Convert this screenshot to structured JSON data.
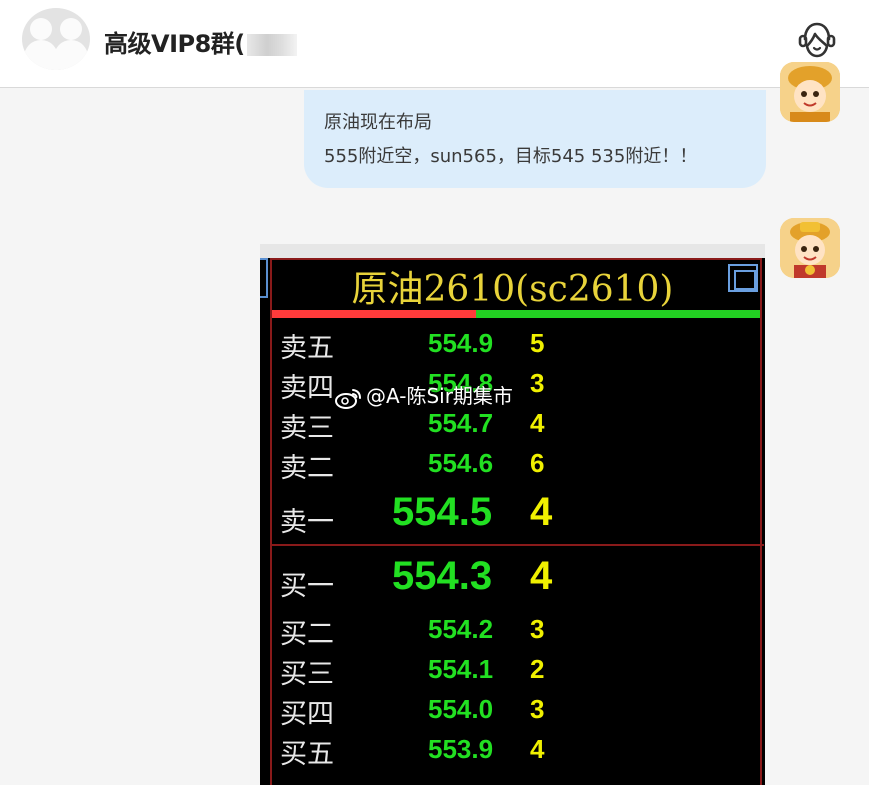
{
  "header": {
    "title": "高级VIP8群(",
    "service_icon": "customer-service-icon"
  },
  "messages": {
    "text_message": {
      "line1": "原油现在布局",
      "line2": "555附近空，sun565，目标545 535附近！！"
    },
    "image_message": {
      "quote_title": "原油2610(sc2610)",
      "asks": [
        {
          "label": "卖五",
          "price": "554.9",
          "qty": "5"
        },
        {
          "label": "卖四",
          "price": "554.8",
          "qty": "3"
        },
        {
          "label": "卖三",
          "price": "554.7",
          "qty": "4"
        },
        {
          "label": "卖二",
          "price": "554.6",
          "qty": "6"
        },
        {
          "label": "卖一",
          "price": "554.5",
          "qty": "4"
        }
      ],
      "bids": [
        {
          "label": "买一",
          "price": "554.3",
          "qty": "4"
        },
        {
          "label": "买二",
          "price": "554.2",
          "qty": "3"
        },
        {
          "label": "买三",
          "price": "554.1",
          "qty": "2"
        },
        {
          "label": "买四",
          "price": "554.0",
          "qty": "3"
        },
        {
          "label": "买五",
          "price": "553.9",
          "qty": "4"
        }
      ],
      "watermark": "@A-陈Sir期集市"
    }
  },
  "colors": {
    "bubble_bg": "#dcedfb",
    "price_green": "#22e022",
    "qty_yellow": "#f0f000",
    "title_yellow": "#e8d33a",
    "frame_red": "#8a1a1a"
  }
}
